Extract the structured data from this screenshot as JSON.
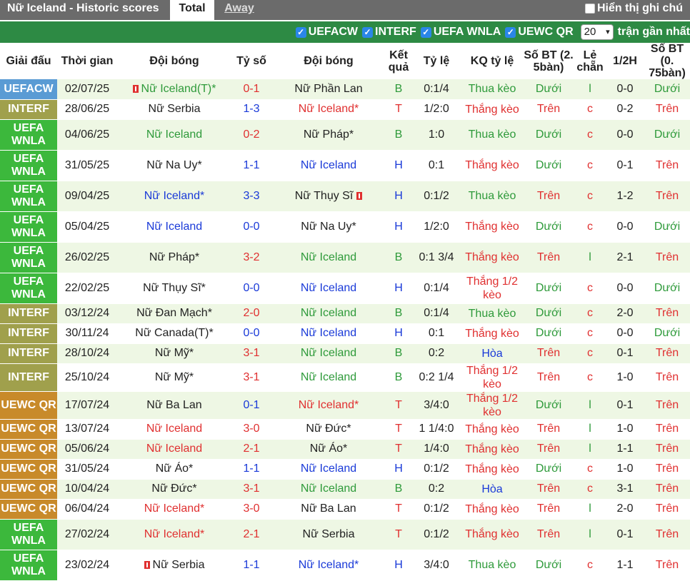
{
  "header": {
    "title": "Nữ Iceland - Historic scores",
    "tabs": [
      "Total",
      "Away"
    ],
    "show_checkbox_label": "Hiển thị ghi chú"
  },
  "filters": {
    "options": [
      "UEFACW",
      "INTERF",
      "UEFA WNLA",
      "UEWC QR"
    ],
    "count": "20",
    "recent_label": "trận gần nhất"
  },
  "colors": {
    "green_bar": "#2d8a44",
    "UEFACW": "#5a9bd4",
    "INTERF": "#a0a04c",
    "UEFA WNLA": "#3cb83c",
    "UEWC QR": "#c88a2a",
    "red": "#e03030",
    "green": "#2e9a3a",
    "blue": "#1a3ad8"
  },
  "columns": [
    "Giải đấu",
    "Thời gian",
    "Đội bóng",
    "Tỷ số",
    "Đội bóng",
    "Kết quả",
    "Tỷ lệ",
    "KQ tỷ lệ",
    "Số BT (2. 5bàn)",
    "Lẻ chẵn",
    "1/2H",
    "Số BT (0. 75bàn)"
  ],
  "rows": [
    {
      "league": "UEFACW",
      "date": "02/07/25",
      "home": "Nữ Iceland(T)*",
      "home_c": "green",
      "home_card": true,
      "score": "0-1",
      "score_c": "red",
      "away": "Nữ Phần Lan",
      "away_c": "dark",
      "res": "B",
      "res_c": "green",
      "odds": "0:1/4",
      "kq": "Thua kèo",
      "kq_c": "green",
      "ou": "Dưới",
      "ou_c": "green",
      "oe": "l",
      "oe_c": "green",
      "ht": "0-0",
      "ou2": "Dưới",
      "ou2_c": "green"
    },
    {
      "league": "INTERF",
      "date": "28/06/25",
      "home": "Nữ Serbia",
      "home_c": "dark",
      "score": "1-3",
      "score_c": "blue",
      "away": "Nữ Iceland*",
      "away_c": "red",
      "res": "T",
      "res_c": "red",
      "odds": "1/2:0",
      "kq": "Thắng kèo",
      "kq_c": "red",
      "ou": "Trên",
      "ou_c": "red",
      "oe": "c",
      "oe_c": "red",
      "ht": "0-2",
      "ou2": "Trên",
      "ou2_c": "red"
    },
    {
      "league": "UEFA WNLA",
      "date": "04/06/25",
      "home": "Nữ Iceland",
      "home_c": "green",
      "score": "0-2",
      "score_c": "red",
      "away": "Nữ Pháp*",
      "away_c": "dark",
      "res": "B",
      "res_c": "green",
      "odds": "1:0",
      "kq": "Thua kèo",
      "kq_c": "green",
      "ou": "Dưới",
      "ou_c": "green",
      "oe": "c",
      "oe_c": "red",
      "ht": "0-0",
      "ou2": "Dưới",
      "ou2_c": "green"
    },
    {
      "league": "UEFA WNLA",
      "date": "31/05/25",
      "home": "Nữ Na Uy*",
      "home_c": "dark",
      "score": "1-1",
      "score_c": "blue",
      "away": "Nữ Iceland",
      "away_c": "blue",
      "res": "H",
      "res_c": "blue",
      "odds": "0:1",
      "kq": "Thắng kèo",
      "kq_c": "red",
      "ou": "Dưới",
      "ou_c": "green",
      "oe": "c",
      "oe_c": "red",
      "ht": "0-1",
      "ou2": "Trên",
      "ou2_c": "red"
    },
    {
      "league": "UEFA WNLA",
      "date": "09/04/25",
      "home": "Nữ Iceland*",
      "home_c": "blue",
      "score": "3-3",
      "score_c": "blue",
      "away": "Nữ Thụy Sĩ",
      "away_c": "dark",
      "away_card": true,
      "res": "H",
      "res_c": "blue",
      "odds": "0:1/2",
      "kq": "Thua kèo",
      "kq_c": "green",
      "ou": "Trên",
      "ou_c": "red",
      "oe": "c",
      "oe_c": "red",
      "ht": "1-2",
      "ou2": "Trên",
      "ou2_c": "red"
    },
    {
      "league": "UEFA WNLA",
      "date": "05/04/25",
      "home": "Nữ Iceland",
      "home_c": "blue",
      "score": "0-0",
      "score_c": "blue",
      "away": "Nữ Na Uy*",
      "away_c": "dark",
      "res": "H",
      "res_c": "blue",
      "odds": "1/2:0",
      "kq": "Thắng kèo",
      "kq_c": "red",
      "ou": "Dưới",
      "ou_c": "green",
      "oe": "c",
      "oe_c": "red",
      "ht": "0-0",
      "ou2": "Dưới",
      "ou2_c": "green"
    },
    {
      "league": "UEFA WNLA",
      "date": "26/02/25",
      "home": "Nữ Pháp*",
      "home_c": "dark",
      "score": "3-2",
      "score_c": "red",
      "away": "Nữ Iceland",
      "away_c": "green",
      "res": "B",
      "res_c": "green",
      "odds": "0:1 3/4",
      "kq": "Thắng kèo",
      "kq_c": "red",
      "ou": "Trên",
      "ou_c": "red",
      "oe": "l",
      "oe_c": "green",
      "ht": "2-1",
      "ou2": "Trên",
      "ou2_c": "red"
    },
    {
      "league": "UEFA WNLA",
      "date": "22/02/25",
      "home": "Nữ Thụy Sĩ*",
      "home_c": "dark",
      "score": "0-0",
      "score_c": "blue",
      "away": "Nữ Iceland",
      "away_c": "blue",
      "res": "H",
      "res_c": "blue",
      "odds": "0:1/4",
      "kq": "Thắng 1/2 kèo",
      "kq_c": "red",
      "ou": "Dưới",
      "ou_c": "green",
      "oe": "c",
      "oe_c": "red",
      "ht": "0-0",
      "ou2": "Dưới",
      "ou2_c": "green"
    },
    {
      "league": "INTERF",
      "date": "03/12/24",
      "home": "Nữ Đan Mạch*",
      "home_c": "dark",
      "score": "2-0",
      "score_c": "red",
      "away": "Nữ Iceland",
      "away_c": "green",
      "res": "B",
      "res_c": "green",
      "odds": "0:1/4",
      "kq": "Thua kèo",
      "kq_c": "green",
      "ou": "Dưới",
      "ou_c": "green",
      "oe": "c",
      "oe_c": "red",
      "ht": "2-0",
      "ou2": "Trên",
      "ou2_c": "red"
    },
    {
      "league": "INTERF",
      "date": "30/11/24",
      "home": "Nữ Canada(T)*",
      "home_c": "dark",
      "score": "0-0",
      "score_c": "blue",
      "away": "Nữ Iceland",
      "away_c": "blue",
      "res": "H",
      "res_c": "blue",
      "odds": "0:1",
      "kq": "Thắng kèo",
      "kq_c": "red",
      "ou": "Dưới",
      "ou_c": "green",
      "oe": "c",
      "oe_c": "red",
      "ht": "0-0",
      "ou2": "Dưới",
      "ou2_c": "green"
    },
    {
      "league": "INTERF",
      "date": "28/10/24",
      "home": "Nữ Mỹ*",
      "home_c": "dark",
      "score": "3-1",
      "score_c": "red",
      "away": "Nữ Iceland",
      "away_c": "green",
      "res": "B",
      "res_c": "green",
      "odds": "0:2",
      "kq": "Hòa",
      "kq_c": "blue",
      "ou": "Trên",
      "ou_c": "red",
      "oe": "c",
      "oe_c": "red",
      "ht": "0-1",
      "ou2": "Trên",
      "ou2_c": "red"
    },
    {
      "league": "INTERF",
      "date": "25/10/24",
      "home": "Nữ Mỹ*",
      "home_c": "dark",
      "score": "3-1",
      "score_c": "red",
      "away": "Nữ Iceland",
      "away_c": "green",
      "res": "B",
      "res_c": "green",
      "odds": "0:2 1/4",
      "kq": "Thắng 1/2 kèo",
      "kq_c": "red",
      "ou": "Trên",
      "ou_c": "red",
      "oe": "c",
      "oe_c": "red",
      "ht": "1-0",
      "ou2": "Trên",
      "ou2_c": "red"
    },
    {
      "league": "UEWC QR",
      "date": "17/07/24",
      "home": "Nữ Ba Lan",
      "home_c": "dark",
      "score": "0-1",
      "score_c": "blue",
      "away": "Nữ Iceland*",
      "away_c": "red",
      "res": "T",
      "res_c": "red",
      "odds": "3/4:0",
      "kq": "Thắng 1/2 kèo",
      "kq_c": "red",
      "ou": "Dưới",
      "ou_c": "green",
      "oe": "l",
      "oe_c": "green",
      "ht": "0-1",
      "ou2": "Trên",
      "ou2_c": "red"
    },
    {
      "league": "UEWC QR",
      "date": "13/07/24",
      "home": "Nữ Iceland",
      "home_c": "red",
      "score": "3-0",
      "score_c": "red",
      "away": "Nữ Đức*",
      "away_c": "dark",
      "res": "T",
      "res_c": "red",
      "odds": "1 1/4:0",
      "kq": "Thắng kèo",
      "kq_c": "red",
      "ou": "Trên",
      "ou_c": "red",
      "oe": "l",
      "oe_c": "green",
      "ht": "1-0",
      "ou2": "Trên",
      "ou2_c": "red"
    },
    {
      "league": "UEWC QR",
      "date": "05/06/24",
      "home": "Nữ Iceland",
      "home_c": "red",
      "score": "2-1",
      "score_c": "red",
      "away": "Nữ Áo*",
      "away_c": "dark",
      "res": "T",
      "res_c": "red",
      "odds": "1/4:0",
      "kq": "Thắng kèo",
      "kq_c": "red",
      "ou": "Trên",
      "ou_c": "red",
      "oe": "l",
      "oe_c": "green",
      "ht": "1-1",
      "ou2": "Trên",
      "ou2_c": "red"
    },
    {
      "league": "UEWC QR",
      "date": "31/05/24",
      "home": "Nữ Áo*",
      "home_c": "dark",
      "score": "1-1",
      "score_c": "blue",
      "away": "Nữ Iceland",
      "away_c": "blue",
      "res": "H",
      "res_c": "blue",
      "odds": "0:1/2",
      "kq": "Thắng kèo",
      "kq_c": "red",
      "ou": "Dưới",
      "ou_c": "green",
      "oe": "c",
      "oe_c": "red",
      "ht": "1-0",
      "ou2": "Trên",
      "ou2_c": "red"
    },
    {
      "league": "UEWC QR",
      "date": "10/04/24",
      "home": "Nữ Đức*",
      "home_c": "dark",
      "score": "3-1",
      "score_c": "red",
      "away": "Nữ Iceland",
      "away_c": "green",
      "res": "B",
      "res_c": "green",
      "odds": "0:2",
      "kq": "Hòa",
      "kq_c": "blue",
      "ou": "Trên",
      "ou_c": "red",
      "oe": "c",
      "oe_c": "red",
      "ht": "3-1",
      "ou2": "Trên",
      "ou2_c": "red"
    },
    {
      "league": "UEWC QR",
      "date": "06/04/24",
      "home": "Nữ Iceland*",
      "home_c": "red",
      "score": "3-0",
      "score_c": "red",
      "away": "Nữ Ba Lan",
      "away_c": "dark",
      "res": "T",
      "res_c": "red",
      "odds": "0:1/2",
      "kq": "Thắng kèo",
      "kq_c": "red",
      "ou": "Trên",
      "ou_c": "red",
      "oe": "l",
      "oe_c": "green",
      "ht": "2-0",
      "ou2": "Trên",
      "ou2_c": "red"
    },
    {
      "league": "UEFA WNLA",
      "date": "27/02/24",
      "home": "Nữ Iceland*",
      "home_c": "red",
      "score": "2-1",
      "score_c": "red",
      "away": "Nữ Serbia",
      "away_c": "dark",
      "res": "T",
      "res_c": "red",
      "odds": "0:1/2",
      "kq": "Thắng kèo",
      "kq_c": "red",
      "ou": "Trên",
      "ou_c": "red",
      "oe": "l",
      "oe_c": "green",
      "ht": "0-1",
      "ou2": "Trên",
      "ou2_c": "red"
    },
    {
      "league": "UEFA WNLA",
      "date": "23/02/24",
      "home": "Nữ Serbia",
      "home_c": "dark",
      "home_card": true,
      "score": "1-1",
      "score_c": "blue",
      "away": "Nữ Iceland*",
      "away_c": "blue",
      "res": "H",
      "res_c": "blue",
      "odds": "3/4:0",
      "kq": "Thua kèo",
      "kq_c": "green",
      "ou": "Dưới",
      "ou_c": "green",
      "oe": "c",
      "oe_c": "red",
      "ht": "1-1",
      "ou2": "Trên",
      "ou2_c": "red"
    }
  ]
}
